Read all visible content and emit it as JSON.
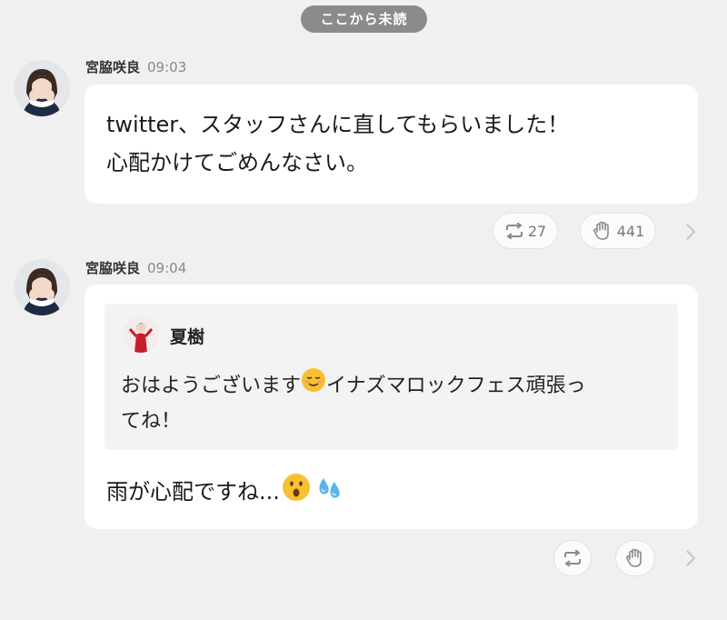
{
  "unread_label": "ここから未読",
  "messages": [
    {
      "sender": "宮脇咲良",
      "time": "09:03",
      "lines": [
        "twitter、スタッフさんに直してもらいました！",
        "心配かけてごめんなさい。"
      ],
      "repost_count": "27",
      "clap_count": "441"
    },
    {
      "sender": "宮脇咲良",
      "time": "09:04",
      "quote": {
        "sender": "夏樹",
        "line1": "おはようございます",
        "line1_after": "イナズマロックフェス頑張っ",
        "line2": "てね！"
      },
      "reply": "雨が心配ですね..."
    }
  ],
  "icons": {
    "repost": "repost-icon",
    "clap": "clap-icon",
    "chevron": "chevron-right-icon",
    "relieved_emoji": "relieved-face-emoji",
    "surprised_emoji": "hushed-face-emoji",
    "sweat_emoji": "sweat-droplets-emoji"
  },
  "colors": {
    "background": "#f0f0f0",
    "pill": "#8b8b8b",
    "bubble": "#ffffff",
    "quote": "#f3f3f3"
  }
}
